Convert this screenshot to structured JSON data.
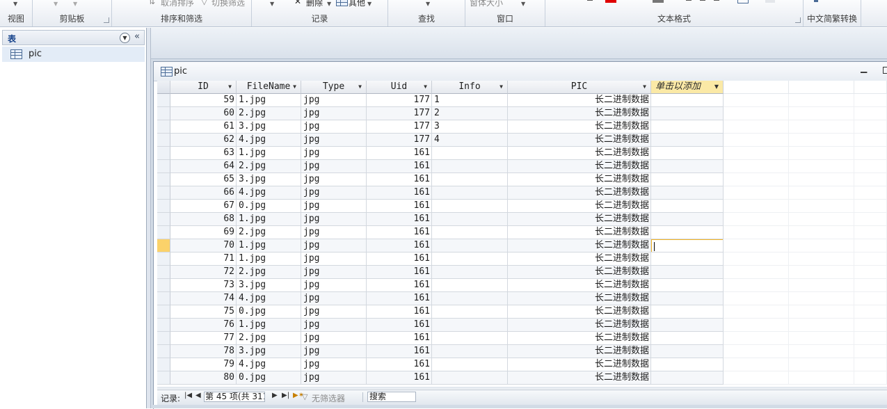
{
  "ribbon": {
    "groups": [
      {
        "label": "视图"
      },
      {
        "label": "剪贴板"
      },
      {
        "label": "排序和筛选"
      },
      {
        "label": "记录"
      },
      {
        "label": "查找"
      },
      {
        "label": "窗口"
      },
      {
        "label": "文本格式"
      },
      {
        "label": "中文简繁转换"
      }
    ],
    "clear_sort_label": "取消排序",
    "toggle_filter_label": "切换筛选",
    "delete_label": "删除",
    "more_label": "其他",
    "window_size_label": "窗体大小"
  },
  "nav": {
    "title": "表",
    "item_label": "pic"
  },
  "doc": {
    "tab_label": "pic"
  },
  "grid": {
    "columns": [
      "ID",
      "FileName",
      "Type",
      "Uid",
      "Info",
      "PIC",
      "单击以添加"
    ],
    "rows": [
      {
        "id": "59",
        "filename": "1.jpg",
        "type": "jpg",
        "uid": "177",
        "info": "1",
        "pic": "长二进制数据"
      },
      {
        "id": "60",
        "filename": "2.jpg",
        "type": "jpg",
        "uid": "177",
        "info": "2",
        "pic": "长二进制数据"
      },
      {
        "id": "61",
        "filename": "3.jpg",
        "type": "jpg",
        "uid": "177",
        "info": "3",
        "pic": "长二进制数据"
      },
      {
        "id": "62",
        "filename": "4.jpg",
        "type": "jpg",
        "uid": "177",
        "info": "4",
        "pic": "长二进制数据"
      },
      {
        "id": "63",
        "filename": "1.jpg",
        "type": "jpg",
        "uid": "161",
        "info": "",
        "pic": "长二进制数据"
      },
      {
        "id": "64",
        "filename": "2.jpg",
        "type": "jpg",
        "uid": "161",
        "info": "",
        "pic": "长二进制数据"
      },
      {
        "id": "65",
        "filename": "3.jpg",
        "type": "jpg",
        "uid": "161",
        "info": "",
        "pic": "长二进制数据"
      },
      {
        "id": "66",
        "filename": "4.jpg",
        "type": "jpg",
        "uid": "161",
        "info": "",
        "pic": "长二进制数据"
      },
      {
        "id": "67",
        "filename": "0.jpg",
        "type": "jpg",
        "uid": "161",
        "info": "",
        "pic": "长二进制数据"
      },
      {
        "id": "68",
        "filename": "1.jpg",
        "type": "jpg",
        "uid": "161",
        "info": "",
        "pic": "长二进制数据"
      },
      {
        "id": "69",
        "filename": "2.jpg",
        "type": "jpg",
        "uid": "161",
        "info": "",
        "pic": "长二进制数据"
      },
      {
        "id": "70",
        "filename": "1.jpg",
        "type": "jpg",
        "uid": "161",
        "info": "",
        "pic": "长二进制数据"
      },
      {
        "id": "71",
        "filename": "1.jpg",
        "type": "jpg",
        "uid": "161",
        "info": "",
        "pic": "长二进制数据"
      },
      {
        "id": "72",
        "filename": "2.jpg",
        "type": "jpg",
        "uid": "161",
        "info": "",
        "pic": "长二进制数据"
      },
      {
        "id": "73",
        "filename": "3.jpg",
        "type": "jpg",
        "uid": "161",
        "info": "",
        "pic": "长二进制数据"
      },
      {
        "id": "74",
        "filename": "4.jpg",
        "type": "jpg",
        "uid": "161",
        "info": "",
        "pic": "长二进制数据"
      },
      {
        "id": "75",
        "filename": "0.jpg",
        "type": "jpg",
        "uid": "161",
        "info": "",
        "pic": "长二进制数据"
      },
      {
        "id": "76",
        "filename": "1.jpg",
        "type": "jpg",
        "uid": "161",
        "info": "",
        "pic": "长二进制数据"
      },
      {
        "id": "77",
        "filename": "2.jpg",
        "type": "jpg",
        "uid": "161",
        "info": "",
        "pic": "长二进制数据"
      },
      {
        "id": "78",
        "filename": "3.jpg",
        "type": "jpg",
        "uid": "161",
        "info": "",
        "pic": "长二进制数据"
      },
      {
        "id": "79",
        "filename": "4.jpg",
        "type": "jpg",
        "uid": "161",
        "info": "",
        "pic": "长二进制数据"
      },
      {
        "id": "80",
        "filename": "0.jpg",
        "type": "jpg",
        "uid": "161",
        "info": "",
        "pic": "长二进制数据"
      }
    ],
    "current_row_id": "70"
  },
  "recordnav": {
    "label": "记录:",
    "position_text": "第 45 项(共 311",
    "filter_label": "无筛选器",
    "search_label": "搜索"
  },
  "colors": {
    "accent_header": "#fbe9a6",
    "current_row_marker": "#fbd26a",
    "active_cell_border": "#f3b422",
    "nav_title": "#15428b"
  }
}
